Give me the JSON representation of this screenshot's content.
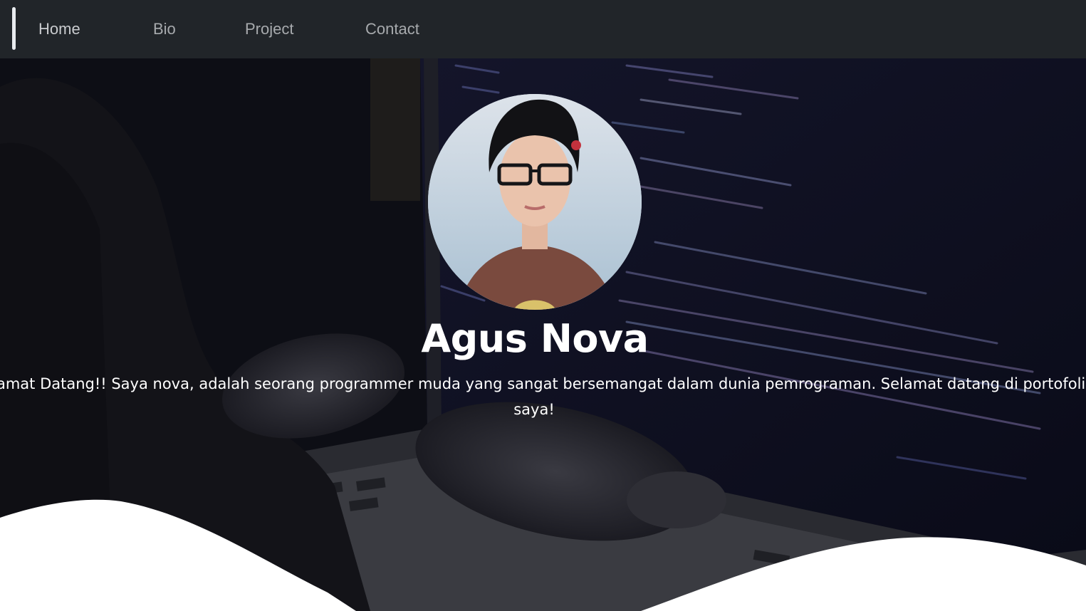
{
  "nav": {
    "items": [
      {
        "label": "Home"
      },
      {
        "label": "Bio"
      },
      {
        "label": "Project"
      },
      {
        "label": "Contact"
      }
    ]
  },
  "hero": {
    "name": "Agus Nova",
    "description": "Selamat Datang!! Saya nova, adalah seorang programmer muda yang sangat bersemangat dalam dunia pemrograman. Selamat datang di portofolio saya!"
  },
  "colors": {
    "navbar_bg": "#212529",
    "nav_text": "#a7aaad",
    "hero_text": "#ffffff",
    "wave": "#ffffff"
  }
}
